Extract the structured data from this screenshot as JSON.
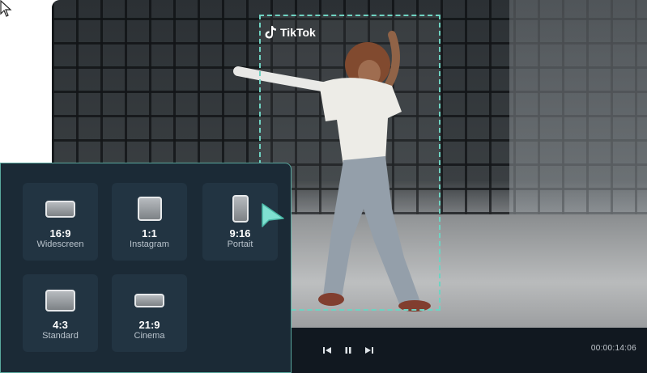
{
  "video": {
    "platform_label": "TikTok",
    "timecode": "00:00:14:06",
    "controls": {
      "prev_icon": "skip-back-icon",
      "pause_icon": "pause-icon",
      "next_icon": "skip-forward-icon"
    }
  },
  "ratio_panel": {
    "options": [
      {
        "ratio": "16:9",
        "name": "Widescreen",
        "selected": false
      },
      {
        "ratio": "1:1",
        "name": "Instagram",
        "selected": false
      },
      {
        "ratio": "9:16",
        "name": "Portait",
        "selected": true
      },
      {
        "ratio": "4:3",
        "name": "Standard",
        "selected": false
      },
      {
        "ratio": "21:9",
        "name": "Cinema",
        "selected": false
      }
    ]
  },
  "colors": {
    "accent": "#6fd3c2",
    "panel_bg": "#1b2a36",
    "card_bg": "#223442",
    "control_bar": "#111820"
  }
}
